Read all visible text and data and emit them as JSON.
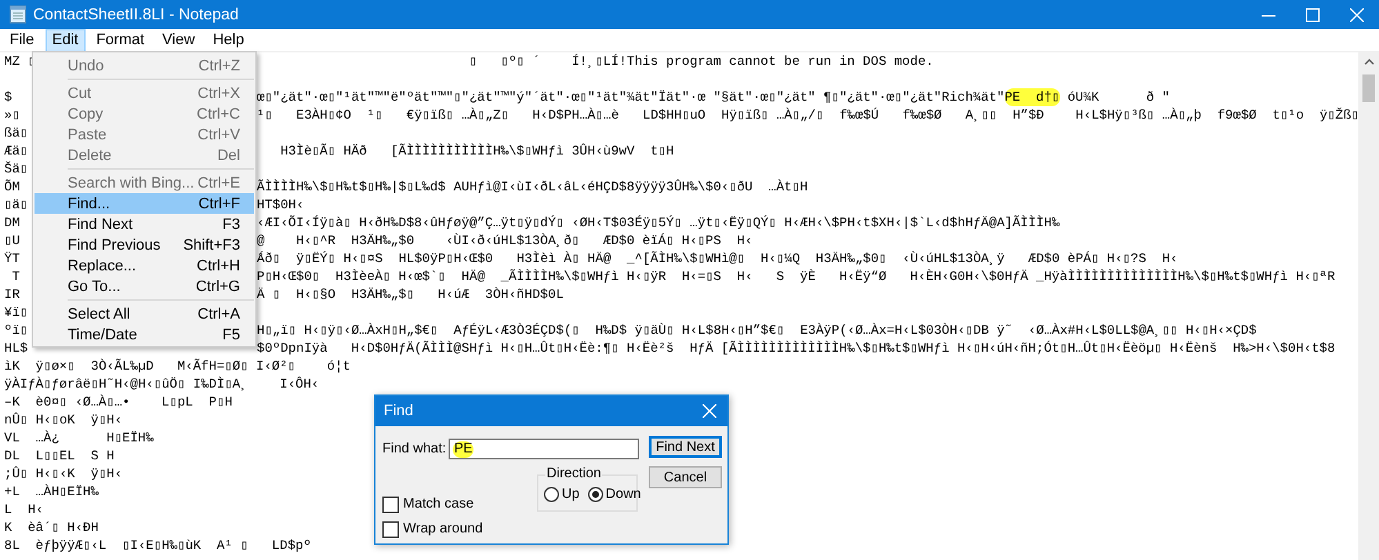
{
  "window": {
    "title": "ContactSheetII.8LI - Notepad"
  },
  "menu_bar": [
    {
      "label": "File",
      "selected": false
    },
    {
      "label": "Edit",
      "selected": true
    },
    {
      "label": "Format",
      "selected": false
    },
    {
      "label": "View",
      "selected": false
    },
    {
      "label": "Help",
      "selected": false
    }
  ],
  "edit_menu": {
    "items": [
      {
        "kind": "item",
        "label": "Undo",
        "shortcut": "Ctrl+Z",
        "disabled": true,
        "selected": false
      },
      {
        "kind": "separator"
      },
      {
        "kind": "item",
        "label": "Cut",
        "shortcut": "Ctrl+X",
        "disabled": true,
        "selected": false
      },
      {
        "kind": "item",
        "label": "Copy",
        "shortcut": "Ctrl+C",
        "disabled": true,
        "selected": false
      },
      {
        "kind": "item",
        "label": "Paste",
        "shortcut": "Ctrl+V",
        "disabled": true,
        "selected": false
      },
      {
        "kind": "item",
        "label": "Delete",
        "shortcut": "Del",
        "disabled": true,
        "selected": false
      },
      {
        "kind": "separator"
      },
      {
        "kind": "item",
        "label": "Search with Bing...",
        "shortcut": "Ctrl+E",
        "disabled": true,
        "selected": false
      },
      {
        "kind": "item",
        "label": "Find...",
        "shortcut": "Ctrl+F",
        "disabled": false,
        "selected": true
      },
      {
        "kind": "item",
        "label": "Find Next",
        "shortcut": "F3",
        "disabled": false,
        "selected": false
      },
      {
        "kind": "item",
        "label": "Find Previous",
        "shortcut": "Shift+F3",
        "disabled": false,
        "selected": false
      },
      {
        "kind": "item",
        "label": "Replace...",
        "shortcut": "Ctrl+H",
        "disabled": false,
        "selected": false
      },
      {
        "kind": "item",
        "label": "Go To...",
        "shortcut": "Ctrl+G",
        "disabled": false,
        "selected": false
      },
      {
        "kind": "separator"
      },
      {
        "kind": "item",
        "label": "Select All",
        "shortcut": "Ctrl+A",
        "disabled": false,
        "selected": false
      },
      {
        "kind": "item",
        "label": "Time/Date",
        "shortcut": "F5",
        "disabled": false,
        "selected": false
      }
    ]
  },
  "editor": {
    "lines": [
      {
        "kind": "text",
        "left": "MZ ▯",
        "segments": [
          {
            "text": "                           ▯   ▯º▯ ´    Í!¸▯LÍ!This program cannot be run in DOS mode.",
            "highlighted": false
          }
        ]
      },
      {
        "kind": "blank"
      },
      {
        "kind": "text",
        "left": "$",
        "segments": [
          {
            "text": "œ▯\"¿ät\"·œ▯\"¹ät\"™\"ë\"ºät\"™\"▯\"¿ät\"™\"ý\"´ät\"·œ▯\"¹ät\"¾ät\"Ïät\"·œ \"§ät\"·œ▯\"¿ät\" ¶▯\"¿ät\"·œ▯\"¿ät\"Rich¾ät\"",
            "highlighted": false
          },
          {
            "text": "PE  d†▯",
            "highlighted": true
          },
          {
            "text": " óU¾K      ð \"",
            "highlighted": false
          }
        ]
      },
      {
        "kind": "text",
        "left": "»▯",
        "segments": [
          {
            "text": "¹▯   E3ÀH▯¢O  ¹▯   €ÿ▯ïß▯ …À▯„Z▯   H‹D$PH…À▯…è   LD$HH▯uO  Hÿ▯ïß▯ …À▯„/▯  f‰œ$Ú   f‰œ$Ø   A¸▯▯  H”$Ð    H‹L$Hÿ▯³ß▯ …À▯„þ  f9œ$Ø  t▯¹o  ÿ▯Žß▯",
            "highlighted": false
          }
        ]
      },
      {
        "kind": "text",
        "left": "ßä▯"
      },
      {
        "kind": "text",
        "left": "Æä▯",
        "segments": [
          {
            "text": "   H3Ìè▯Ã▯ HÄð   [ÃÌÌÌÌÌÌÌÌÌÌÌH‰\\$▯WHƒì 3ÛH‹ù9wV  t▯H",
            "highlighted": false
          }
        ]
      },
      {
        "kind": "text",
        "left": "Šä▯"
      },
      {
        "kind": "text",
        "left": "ÕM",
        "segments": [
          {
            "text": "ÃÌÌÌÌH‰\\$▯H‰t$▯H‰|$▯L‰d$ AUHƒì@I‹ùI‹ðL‹âL‹éHÇD$8ÿÿÿÿ3ÛH‰\\$0‹▯ðU  …Àt▯H",
            "highlighted": false
          }
        ]
      },
      {
        "kind": "text",
        "left": "▯ä▯",
        "segments": [
          {
            "text": "HT$0H‹",
            "highlighted": false
          }
        ]
      },
      {
        "kind": "text",
        "left": "DM",
        "segments": [
          {
            "text": "‹ÆI‹ÕI‹Íÿ▯à▯ H‹ðH‰D$8‹ûHƒøÿ@”Ç…ÿt▯ÿ▯dÝ▯ ‹ØH‹T$03Éÿ▯5Ý▯ …ÿt▯‹Ëÿ▯QÝ▯ H‹ÆH‹\\$PH‹t$XH‹|$`L‹d$hHƒÄ@A]ÃÌÌÌH‰",
            "highlighted": false
          }
        ]
      },
      {
        "kind": "text",
        "left": "▯U",
        "segments": [
          {
            "text": "@    H‹▯^R  H3ÄH‰„$0    ‹ÙI‹ð‹úHL$13ÒA¸ð▯   ÆD$0 èïÁ▯ H‹▯PS  H‹",
            "highlighted": false
          }
        ]
      },
      {
        "kind": "text",
        "left": "ŸT",
        "segments": [
          {
            "text": "Ǻð▯  ÿ▯ËÝ▯ H‹▯¤S  HL$0ÿP▯H‹Œ$0   H3Ìèì À▯ HÄ@  _^[ÃÌH‰\\$▯WHì@▯  H‹▯¼Q  H3ÄH‰„$0▯  ‹Ù‹úHL$13ÒA¸ÿ   ÆD$0 èPÁ▯ H‹▯?S  H‹",
            "highlighted": false
          }
        ]
      },
      {
        "kind": "text",
        "left": " T",
        "segments": [
          {
            "text": "P▯H‹Œ$0▯  H3ÌèeÀ▯ H‹œ$`▯  HÄ@  _ÃÌÌÌÌH‰\\$▯WHƒì H‹▯ÿR  H‹=▯S  H‹   S  ÿÈ   H‹Ëÿ“Ø   H‹ÈH‹G0H‹\\$0HƒÄ _HÿàÌÌÌÌÌÌÌÌÌÌÌÌÌÌH‰\\$▯H‰t$▯WHƒì H‹▯ªR",
            "highlighted": false
          }
        ]
      },
      {
        "kind": "text",
        "left": "IR",
        "segments": [
          {
            "text": "Ä ▯  H‹▯§O  H3ÄH‰„$▯   H‹úÆ  3ÒH‹ñHD$0L",
            "highlighted": false
          }
        ]
      },
      {
        "kind": "text",
        "left": "¥ï▯"
      },
      {
        "kind": "text",
        "left": "ºï▯",
        "segments": [
          {
            "text": "H▯„ï▯ H‹▯ÿ▯‹Ø…ÀxH▯H„$€▯  AƒÉÿL‹Æ3Ò3ÉÇD$(▯  H‰D$ ÿ▯äÙ▯ H‹L$8H‹▯H”$€▯  E3ÀÿP(‹Ø…Àx=H‹L$03ÒH‹▯DB ÿ˜  ‹Ø…Àx#H‹L$0LL$@A¸▯▯ H‹▯H‹×ÇD$",
            "highlighted": false
          }
        ]
      },
      {
        "kind": "text",
        "left": "HL$",
        "segments": [
          {
            "text": "$0ºDpnIÿà   H‹D$0HƒÄ(ÃÌÌÌ@SHƒì H‹▯H…Ût▯H‹Ëè:¶▯ H‹Ëè²š  HƒÄ [ÃÌÌÌÌÌÌÌÌÌÌÌÌÌH‰\\$▯H‰t$▯WHƒì H‹▯H‹úH‹ñH;Ót▯H…Ût▯H‹Ëèöµ▯ H‹Ëènš  H‰>H‹\\$0H‹t$8",
            "highlighted": false
          }
        ]
      },
      {
        "kind": "text",
        "left": "ìK  ÿ▯ø×▯  3Ò‹ÃL‰µD   M‹ÃfH=▯Ø▯ I‹Ø²▯    ó¦t"
      },
      {
        "kind": "text",
        "left": "ÿÀIƒÀ▯ƒørâë▯H˜H‹@H‹▯ûÖ▯ I‰DÌ▯A¸    I‹ÔH‹"
      },
      {
        "kind": "text",
        "left": "–K  è0¤▯ ‹Ø…À▯…•    L▯pL  P▯H"
      },
      {
        "kind": "text",
        "left": "nÛ▯ H‹▯oK  ÿ▯H‹"
      },
      {
        "kind": "text",
        "left": "VL  …À¿      H▯EÏH‰"
      },
      {
        "kind": "text",
        "left": "DL  L▯▯EL  S H"
      },
      {
        "kind": "text",
        "left": ";Û▯ H‹▯‹K  ÿ▯H‹"
      },
      {
        "kind": "text",
        "left": "+L  …ÀH▯EÏH‰"
      },
      {
        "kind": "text",
        "left": "L  H‹"
      },
      {
        "kind": "text",
        "left": "K  èâ´▯ H‹ÐH"
      },
      {
        "kind": "text",
        "left": "8L  èƒþÿÿÆ▯‹L  ▯I‹E▯H‰▯ùK  A¹ ▯   LD$pº"
      }
    ]
  },
  "find_dialog": {
    "title": "Find",
    "find_what": {
      "label": "Find what:",
      "value": "PE",
      "highlighted": true
    },
    "buttons": [
      {
        "label": "Find Next",
        "default": true
      },
      {
        "label": "Cancel",
        "default": false
      }
    ],
    "direction": {
      "label": "Direction",
      "options": [
        {
          "label": "Up",
          "selected": false
        },
        {
          "label": "Down",
          "selected": true
        }
      ]
    },
    "checkboxes": [
      {
        "label": "Match case",
        "checked": false
      },
      {
        "label": "Wrap around",
        "checked": false
      }
    ]
  }
}
